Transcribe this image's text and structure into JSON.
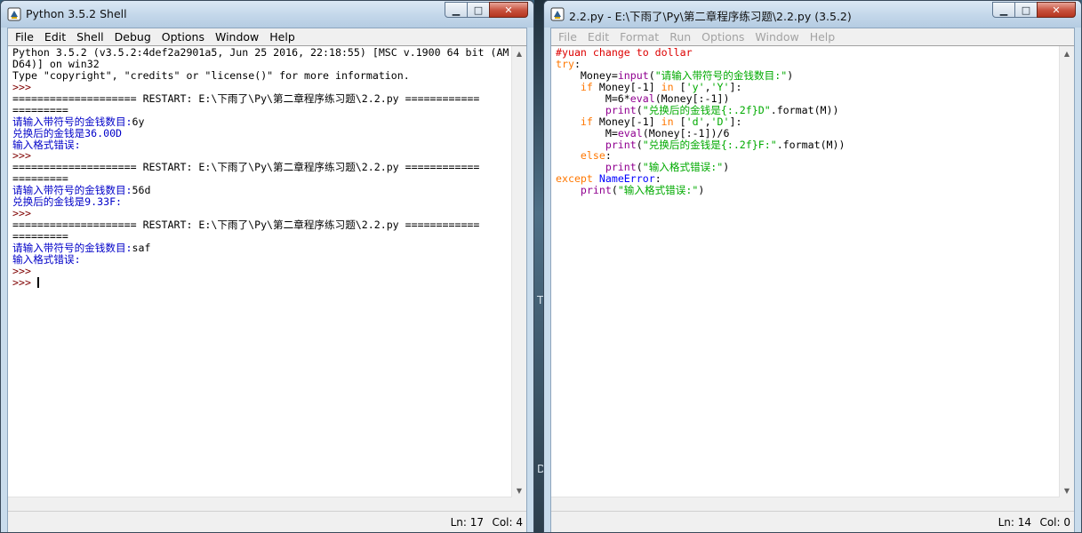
{
  "shell": {
    "title": "Python 3.5.2 Shell",
    "menu": [
      "File",
      "Edit",
      "Shell",
      "Debug",
      "Options",
      "Window",
      "Help"
    ],
    "lines": [
      [
        {
          "t": "Python 3.5.2 (v3.5.2:4def2a2901a5, Jun 25 2016, 22:18:55) [MSC v.1900 64 bit (AM",
          "c": "out"
        }
      ],
      [
        {
          "t": "D64)] on win32",
          "c": "out"
        }
      ],
      [
        {
          "t": "Type \"copyright\", \"credits\" or \"license()\" for more information.",
          "c": "out"
        }
      ],
      [
        {
          "t": ">>> ",
          "c": "prompt"
        }
      ],
      [
        {
          "t": "==================== RESTART: E:\\下雨了\\Py\\第二章程序练习题\\2.2.py ============",
          "c": "out"
        }
      ],
      [
        {
          "t": "=========",
          "c": "out"
        }
      ],
      [
        {
          "t": "请输入带符号的金钱数目:",
          "c": "stdout"
        },
        {
          "t": "6y",
          "c": "out"
        }
      ],
      [
        {
          "t": "兑换后的金钱是36.00D",
          "c": "stdout"
        }
      ],
      [
        {
          "t": "输入格式错误:",
          "c": "stdout"
        }
      ],
      [
        {
          "t": ">>> ",
          "c": "prompt"
        }
      ],
      [
        {
          "t": "==================== RESTART: E:\\下雨了\\Py\\第二章程序练习题\\2.2.py ============",
          "c": "out"
        }
      ],
      [
        {
          "t": "=========",
          "c": "out"
        }
      ],
      [
        {
          "t": "请输入带符号的金钱数目:",
          "c": "stdout"
        },
        {
          "t": "56d",
          "c": "out"
        }
      ],
      [
        {
          "t": "兑换后的金钱是9.33F:",
          "c": "stdout"
        }
      ],
      [
        {
          "t": ">>> ",
          "c": "prompt"
        }
      ],
      [
        {
          "t": "==================== RESTART: E:\\下雨了\\Py\\第二章程序练习题\\2.2.py ============",
          "c": "out"
        }
      ],
      [
        {
          "t": "=========",
          "c": "out"
        }
      ],
      [
        {
          "t": "请输入带符号的金钱数目:",
          "c": "stdout"
        },
        {
          "t": "saf",
          "c": "out"
        }
      ],
      [
        {
          "t": "输入格式错误:",
          "c": "stdout"
        }
      ],
      [
        {
          "t": ">>> ",
          "c": "prompt"
        }
      ],
      [
        {
          "t": ">>> ",
          "c": "prompt"
        },
        {
          "cursor": true
        }
      ]
    ],
    "status": {
      "line": "Ln: 17",
      "col": "Col: 4"
    }
  },
  "editor": {
    "title": "2.2.py - E:\\下雨了\\Py\\第二章程序练习题\\2.2.py (3.5.2)",
    "menu": [
      "File",
      "Edit",
      "Format",
      "Run",
      "Options",
      "Window",
      "Help"
    ],
    "lines": [
      [
        {
          "t": "#yuan change to dollar",
          "c": "comment"
        }
      ],
      [
        {
          "t": "try",
          "c": "kw"
        },
        {
          "t": ":",
          "c": "out"
        }
      ],
      [
        {
          "t": "    Money=",
          "c": "out"
        },
        {
          "t": "input",
          "c": "builtin"
        },
        {
          "t": "(",
          "c": "out"
        },
        {
          "t": "\"请输入带符号的金钱数目:\"",
          "c": "str"
        },
        {
          "t": ")",
          "c": "out"
        }
      ],
      [
        {
          "t": "    ",
          "c": "out"
        },
        {
          "t": "if",
          "c": "kw"
        },
        {
          "t": " Money[-1] ",
          "c": "out"
        },
        {
          "t": "in",
          "c": "kw"
        },
        {
          "t": " [",
          "c": "out"
        },
        {
          "t": "'y'",
          "c": "str"
        },
        {
          "t": ",",
          "c": "out"
        },
        {
          "t": "'Y'",
          "c": "str"
        },
        {
          "t": "]:",
          "c": "out"
        }
      ],
      [
        {
          "t": "        M=6*",
          "c": "out"
        },
        {
          "t": "eval",
          "c": "builtin"
        },
        {
          "t": "(Money[:-1])",
          "c": "out"
        }
      ],
      [
        {
          "t": "        ",
          "c": "out"
        },
        {
          "t": "print",
          "c": "builtin"
        },
        {
          "t": "(",
          "c": "out"
        },
        {
          "t": "\"兑换后的金钱是{:.2f}D\"",
          "c": "str"
        },
        {
          "t": ".format(M))",
          "c": "out"
        }
      ],
      [
        {
          "t": "    ",
          "c": "out"
        },
        {
          "t": "if",
          "c": "kw"
        },
        {
          "t": " Money[-1] ",
          "c": "out"
        },
        {
          "t": "in",
          "c": "kw"
        },
        {
          "t": " [",
          "c": "out"
        },
        {
          "t": "'d'",
          "c": "str"
        },
        {
          "t": ",",
          "c": "out"
        },
        {
          "t": "'D'",
          "c": "str"
        },
        {
          "t": "]:",
          "c": "out"
        }
      ],
      [
        {
          "t": "        M=",
          "c": "out"
        },
        {
          "t": "eval",
          "c": "builtin"
        },
        {
          "t": "(Money[:-1])/6",
          "c": "out"
        }
      ],
      [
        {
          "t": "        ",
          "c": "out"
        },
        {
          "t": "print",
          "c": "builtin"
        },
        {
          "t": "(",
          "c": "out"
        },
        {
          "t": "\"兑换后的金钱是{:.2f}F:\"",
          "c": "str"
        },
        {
          "t": ".format(M))",
          "c": "out"
        }
      ],
      [
        {
          "t": "    ",
          "c": "out"
        },
        {
          "t": "else",
          "c": "kw"
        },
        {
          "t": ":",
          "c": "out"
        }
      ],
      [
        {
          "t": "        ",
          "c": "out"
        },
        {
          "t": "print",
          "c": "builtin"
        },
        {
          "t": "(",
          "c": "out"
        },
        {
          "t": "\"输入格式错误:\"",
          "c": "str"
        },
        {
          "t": ")",
          "c": "out"
        }
      ],
      [
        {
          "t": "except",
          "c": "kw"
        },
        {
          "t": " ",
          "c": "out"
        },
        {
          "t": "NameError",
          "c": "def"
        },
        {
          "t": ":",
          "c": "out"
        }
      ],
      [
        {
          "t": "    ",
          "c": "out"
        },
        {
          "t": "print",
          "c": "builtin"
        },
        {
          "t": "(",
          "c": "out"
        },
        {
          "t": "\"输入格式错误:\"",
          "c": "str"
        },
        {
          "t": ")",
          "c": "out"
        }
      ]
    ],
    "status": {
      "line": "Ln: 14",
      "col": "Col: 0"
    }
  },
  "window_buttons": {
    "minimize": "▁",
    "maximize": "□",
    "close": "✕"
  },
  "desktop_glyphs": [
    "T",
    "D"
  ]
}
